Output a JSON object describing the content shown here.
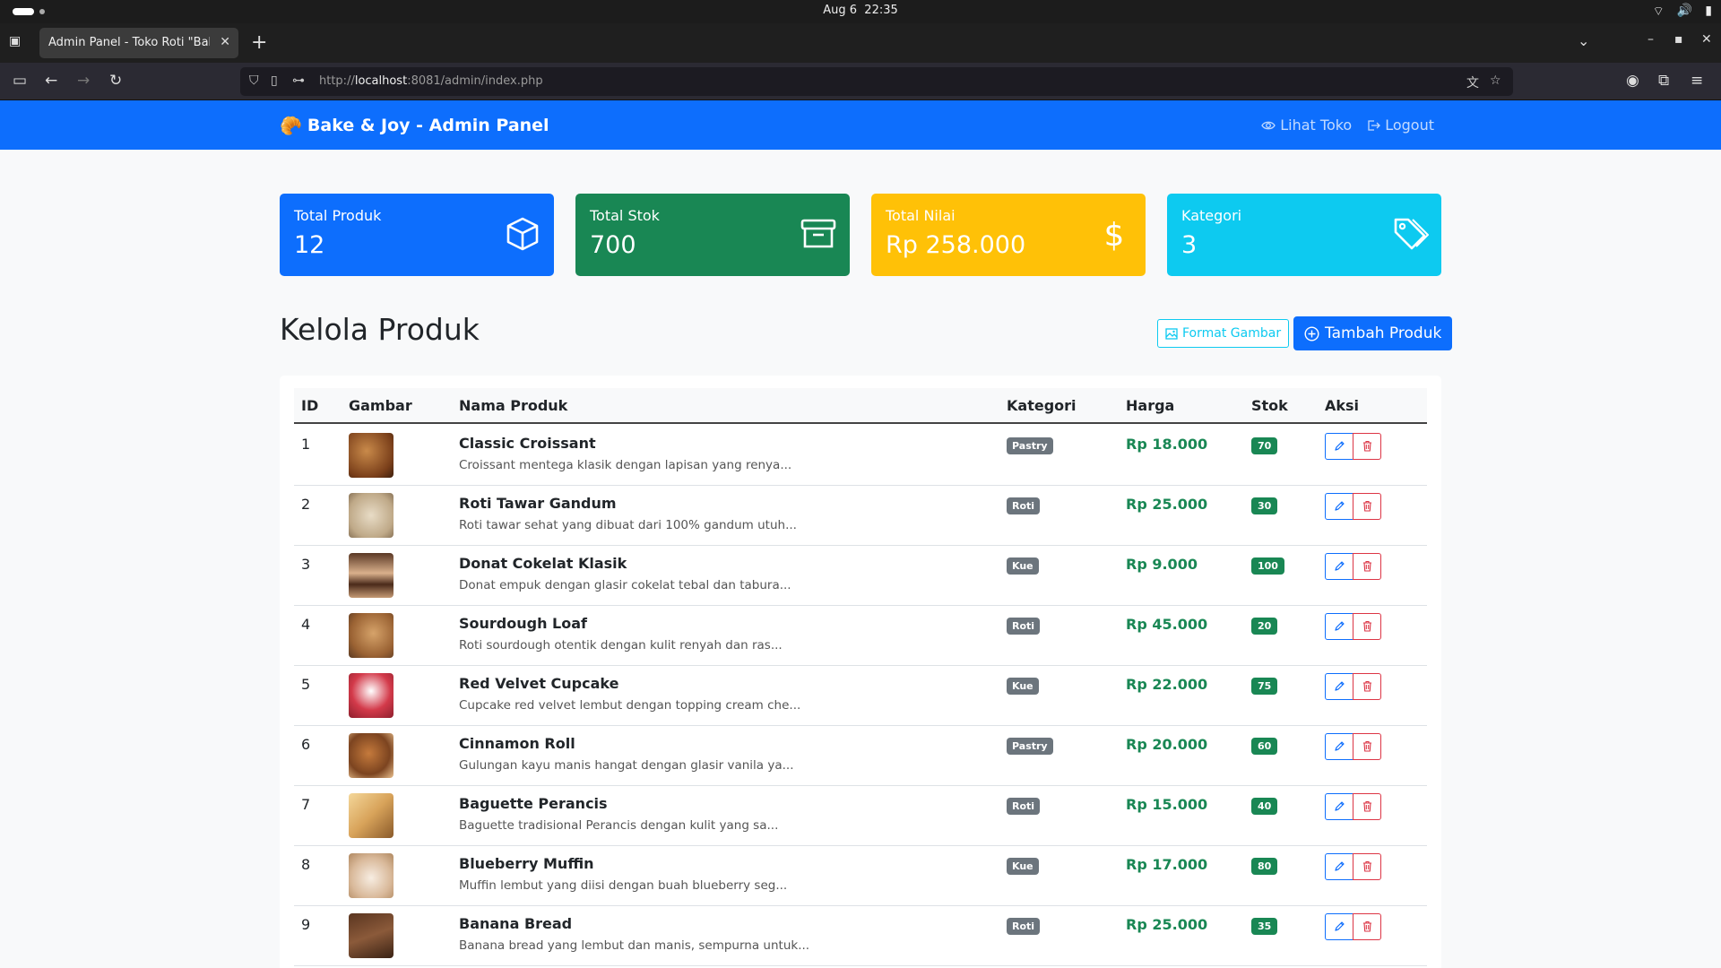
{
  "os": {
    "date": "Aug 6",
    "time": "22:35"
  },
  "browser": {
    "tab_title": "Admin Panel - Toko Roti \"Bake & Joy\"",
    "url_prefix": "http://",
    "url_host": "localhost",
    "url_rest": ":8081/admin/index.php"
  },
  "navbar": {
    "brand": "Bake & Joy - Admin Panel",
    "brand_icon": "🥐",
    "links": [
      {
        "label": "Lihat Toko",
        "icon": "eye-icon"
      },
      {
        "label": "Logout",
        "icon": "logout-icon"
      }
    ]
  },
  "stats": [
    {
      "label": "Total Produk",
      "value": "12",
      "color": "#0d6efd",
      "icon": "box-icon"
    },
    {
      "label": "Total Stok",
      "value": "700",
      "color": "#198754",
      "icon": "archive-icon"
    },
    {
      "label": "Total Nilai",
      "value": "Rp 258.000",
      "color": "#ffc107",
      "icon": "dollar-icon"
    },
    {
      "label": "Kategori",
      "value": "3",
      "color": "#0dcaf0",
      "icon": "tag-icon"
    }
  ],
  "section": {
    "title": "Kelola Produk",
    "format_button": "Format Gambar",
    "add_button": "Tambah Produk"
  },
  "table": {
    "headers": [
      "ID",
      "Gambar",
      "Nama Produk",
      "Kategori",
      "Harga",
      "Stok",
      "Aksi"
    ],
    "rows": [
      {
        "id": "1",
        "name": "Classic Croissant",
        "desc": "Croissant mentega klasik dengan lapisan yang renya...",
        "category": "Pastry",
        "price": "Rp 18.000",
        "stock": "70"
      },
      {
        "id": "2",
        "name": "Roti Tawar Gandum",
        "desc": "Roti tawar sehat yang dibuat dari 100% gandum utuh...",
        "category": "Roti",
        "price": "Rp 25.000",
        "stock": "30"
      },
      {
        "id": "3",
        "name": "Donat Cokelat Klasik",
        "desc": "Donat empuk dengan glasir cokelat tebal dan tabura...",
        "category": "Kue",
        "price": "Rp 9.000",
        "stock": "100"
      },
      {
        "id": "4",
        "name": "Sourdough Loaf",
        "desc": "Roti sourdough otentik dengan kulit renyah dan ras...",
        "category": "Roti",
        "price": "Rp 45.000",
        "stock": "20"
      },
      {
        "id": "5",
        "name": "Red Velvet Cupcake",
        "desc": "Cupcake red velvet lembut dengan topping cream che...",
        "category": "Kue",
        "price": "Rp 22.000",
        "stock": "75"
      },
      {
        "id": "6",
        "name": "Cinnamon Roll",
        "desc": "Gulungan kayu manis hangat dengan glasir vanila ya...",
        "category": "Pastry",
        "price": "Rp 20.000",
        "stock": "60"
      },
      {
        "id": "7",
        "name": "Baguette Perancis",
        "desc": "Baguette tradisional Perancis dengan kulit yang sa...",
        "category": "Roti",
        "price": "Rp 15.000",
        "stock": "40"
      },
      {
        "id": "8",
        "name": "Blueberry Muffin",
        "desc": "Muffin lembut yang diisi dengan buah blueberry seg...",
        "category": "Kue",
        "price": "Rp 17.000",
        "stock": "80"
      },
      {
        "id": "9",
        "name": "Banana Bread",
        "desc": "Banana bread yang lembut dan manis, sempurna untuk...",
        "category": "Roti",
        "price": "Rp 25.000",
        "stock": "35"
      }
    ]
  }
}
